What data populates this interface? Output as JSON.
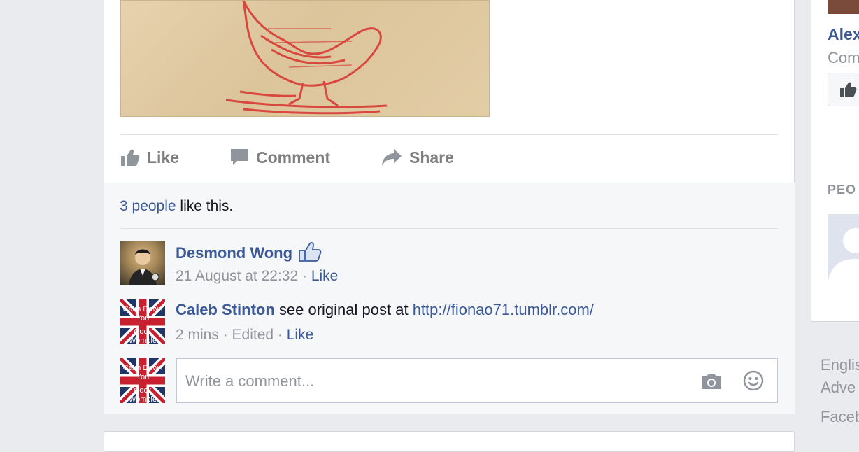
{
  "post": {
    "actions": {
      "like": "Like",
      "comment": "Comment",
      "share": "Share"
    },
    "likes_summary": {
      "count_link": "3 people",
      "suffix": " like this."
    },
    "comments": [
      {
        "author": "Desmond Wong",
        "text": "",
        "timestamp": "21 August at 22:32",
        "separator": " · ",
        "like_label": "Like"
      },
      {
        "author": "Caleb Stinton",
        "text": " see original post at ",
        "link": "http://fionao71.tumblr.com/",
        "timestamp": "2 mins",
        "edited": "Edited",
        "separator": " · ",
        "like_label": "Like"
      }
    ],
    "composer": {
      "placeholder": "Write a comment..."
    },
    "avatar_overlay_text": [
      "Calm Down",
      "You",
      "Cock",
      "Womble"
    ]
  },
  "right_sidebar": {
    "name_partial": "Alex",
    "subtitle_partial": "Com",
    "section_title_partial": "PEO"
  },
  "footer": {
    "language_partial": "Englis",
    "advertising_partial": "Adve",
    "facebook_partial": "Faceb"
  },
  "colors": {
    "link_blue": "#3b5998",
    "meta_gray": "#90949c",
    "page_background": "#e9ebee"
  }
}
